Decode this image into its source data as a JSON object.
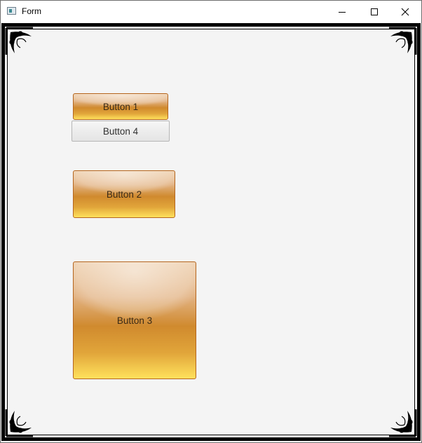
{
  "window": {
    "title": "Form",
    "icon": "app-form-icon",
    "controls": {
      "minimize_icon": "minimize-icon",
      "maximize_icon": "maximize-icon",
      "close_icon": "close-icon"
    }
  },
  "buttons": {
    "button1": "Button 1",
    "button2": "Button 2",
    "button3": "Button 3",
    "button4": "Button 4"
  },
  "colors": {
    "background": "#f4f4f4",
    "frame": "#000000",
    "glossy_border": "#b5651d",
    "glossy_top": "#eccba7",
    "glossy_mid": "#d08a2e",
    "glossy_bottom": "#ffe15c",
    "plain_button_border": "#b6b6b6"
  }
}
